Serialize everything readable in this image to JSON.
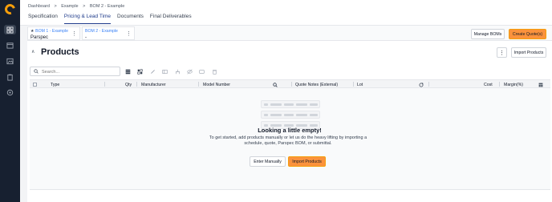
{
  "breadcrumb": [
    "Dashboard",
    ">",
    "Example",
    ">",
    "BOM 2 - Example"
  ],
  "tabs": [
    "Specification",
    "Pricing & Lead Time",
    "Documents",
    "Final Deliverables"
  ],
  "active_tab": "Pricing & Lead Time",
  "bom_tabs": [
    {
      "title": "BOM 1 - Example",
      "subtitle": "Parspec",
      "starred": true
    },
    {
      "title": "BOM 2 - Example",
      "subtitle": "-",
      "starred": false
    }
  ],
  "buttons": {
    "manage_boms": "Manage BOMs",
    "create_quotes": "Create Quote(s)",
    "import_products": "Import Products"
  },
  "products": {
    "title": "Products",
    "search_placeholder": "Search...",
    "columns": [
      "Type",
      "Qty",
      "Manufacturer",
      "Model Number",
      "Quote Notes (External)",
      "Lot",
      "Cost",
      "Margin(%)"
    ]
  },
  "empty_state": {
    "title": "Looking a little empty!",
    "description": "To get started, add products manually or let us do the heavy lifting by importing a schedule, quote, Parspec BOM, or submittal.",
    "enter_manually": "Enter Manually",
    "import_products": "Import Products"
  },
  "colors": {
    "sidebar": "#172030",
    "accent": "#fb923c",
    "brand_logo": "#f59e0b",
    "active_tab": "#1e3a8a",
    "bom_title": "#3b82f6"
  }
}
